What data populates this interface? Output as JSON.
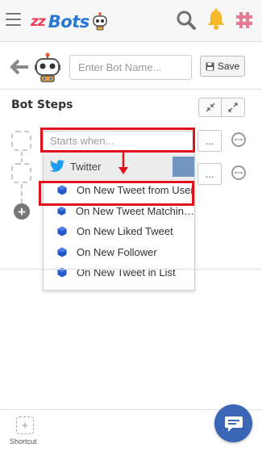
{
  "navbar": {
    "logo_prefix": "zz",
    "logo_word": "Bots"
  },
  "header": {
    "bot_name_placeholder": "Enter Bot Name...",
    "save_label": "Save"
  },
  "bot_steps": {
    "title": "Bot Steps",
    "trigger_placeholder": "Starts when...",
    "dots_label": "..."
  },
  "dropdown": {
    "group_label": "Twitter",
    "items": [
      {
        "label": "On New Tweet from User"
      },
      {
        "label": "On New Tweet Matchin…"
      },
      {
        "label": "On New Liked Tweet"
      },
      {
        "label": "On New Follower"
      },
      {
        "label": "On New Tweet in List"
      }
    ]
  },
  "footer": {
    "shortcut_label": "Shortcut"
  },
  "colors": {
    "accent_red": "#e0101f",
    "brand_blue": "#2a78d6",
    "item_icon_blue": "#2458c7",
    "chat_blue": "#3b66b5",
    "bell_yellow": "#f4b829",
    "hash_pink": "#e57b93"
  }
}
